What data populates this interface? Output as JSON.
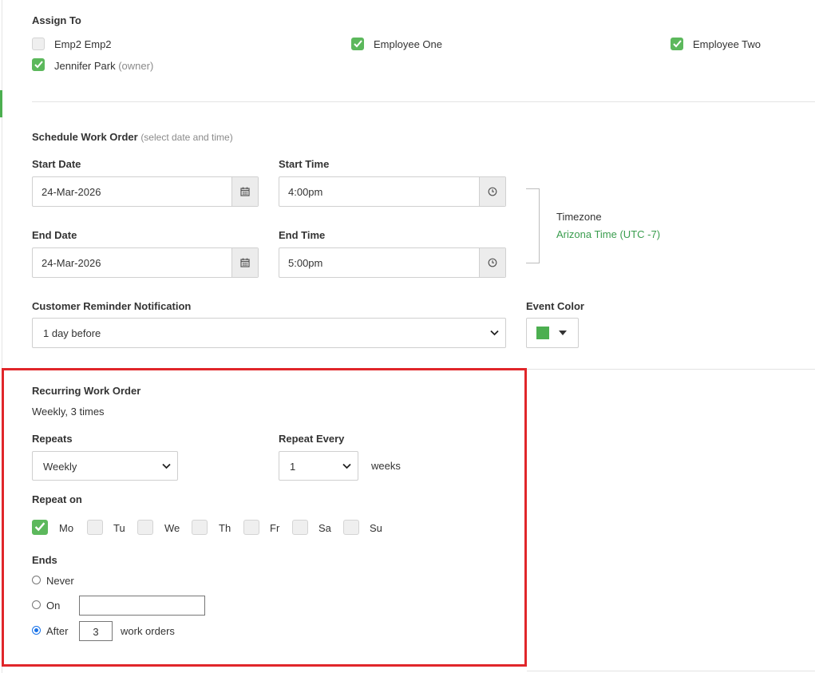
{
  "assign": {
    "title": "Assign To",
    "employees": [
      {
        "name": "Emp2 Emp2",
        "checked": false
      },
      {
        "name": "Employee One",
        "checked": true
      },
      {
        "name": "Employee Two",
        "checked": true
      },
      {
        "name": "Jennifer Park",
        "suffix": "(owner)",
        "checked": true
      }
    ]
  },
  "schedule": {
    "title": "Schedule Work Order",
    "hint": "(select date and time)",
    "start_date_label": "Start Date",
    "start_date": "24-Mar-2026",
    "start_time_label": "Start Time",
    "start_time": "4:00pm",
    "end_date_label": "End Date",
    "end_date": "24-Mar-2026",
    "end_time_label": "End Time",
    "end_time": "5:00pm",
    "timezone_label": "Timezone",
    "timezone": "Arizona Time (UTC -7)",
    "reminder_label": "Customer Reminder Notification",
    "reminder_value": "1 day before",
    "event_color_label": "Event Color",
    "event_color": "#4caf50"
  },
  "recurring": {
    "title": "Recurring Work Order",
    "summary": "Weekly, 3 times",
    "repeats_label": "Repeats",
    "repeats_value": "Weekly",
    "repeat_every_label": "Repeat Every",
    "repeat_every_value": "1",
    "repeat_every_unit": "weeks",
    "repeat_on_label": "Repeat on",
    "days": [
      {
        "label": "Mo",
        "checked": true
      },
      {
        "label": "Tu",
        "checked": false
      },
      {
        "label": "We",
        "checked": false
      },
      {
        "label": "Th",
        "checked": false
      },
      {
        "label": "Fr",
        "checked": false
      },
      {
        "label": "Sa",
        "checked": false
      },
      {
        "label": "Su",
        "checked": false
      }
    ],
    "ends_label": "Ends",
    "ends_never": "Never",
    "ends_on": "On",
    "ends_on_value": "",
    "ends_after": "After",
    "ends_after_value": "3",
    "ends_after_unit": "work orders",
    "ends_selected": "after"
  },
  "colors": {
    "accent": "#5cb85c",
    "highlight_border": "#e0262a",
    "link": "#3a9d4e"
  }
}
